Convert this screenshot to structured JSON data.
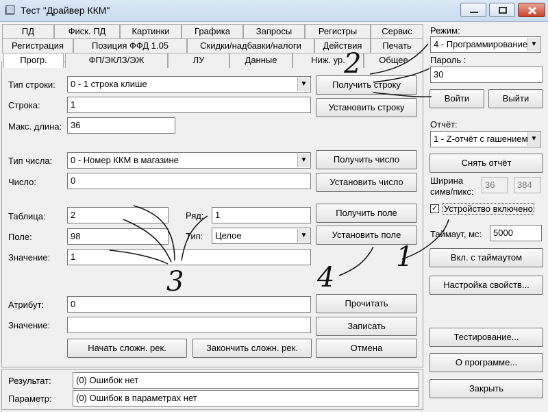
{
  "window": {
    "title": "Тест \"Драйвер ККМ\"",
    "controls": [
      "minimize",
      "maximize",
      "close"
    ]
  },
  "tabs": {
    "row1": [
      "ПД",
      "Фиск. ПД",
      "Картинки",
      "Графика",
      "Запросы",
      "Регистры",
      "Сервис"
    ],
    "row2": [
      "Регистрация",
      "Позиция ФФД 1.05",
      "Скидки/надбавки/налоги",
      "Действия",
      "Печать"
    ],
    "row3": [
      "Прогр.",
      "ФП/ЭКЛЗ/ЭЖ",
      "ЛУ",
      "Данные",
      "Ниж. ур.",
      "Общее"
    ],
    "active": "Прогр."
  },
  "form": {
    "line_type_label": "Тип строки:",
    "line_type_value": "0 - 1 строка клише",
    "get_line_btn": "Получить строку",
    "line_label": "Строка:",
    "line_value": "1",
    "set_line_btn": "Установить строку",
    "maxlen_label": "Макс. длина:",
    "maxlen_value": "36",
    "num_type_label": "Тип числа:",
    "num_type_value": "0 - Номер ККМ в магазине",
    "get_num_btn": "Получить число",
    "num_label": "Число:",
    "num_value": "0",
    "set_num_btn": "Установить число",
    "table_label": "Таблица:",
    "table_value": "2",
    "row_label": "Ряд:",
    "row_value": "1",
    "get_field_btn": "Получить поле",
    "field_label": "Поле:",
    "field_value": "98",
    "type_label": "Тип:",
    "type_value": "Целое",
    "set_field_btn": "Установить поле",
    "value_label": "Значение:",
    "value_value": "1",
    "attr_label": "Атрибут:",
    "attr_value": "0",
    "read_btn": "Прочитать",
    "value2_label": "Значение:",
    "value2_value": "",
    "write_btn": "Записать",
    "start_btn": "Начать сложн. рек.",
    "finish_btn": "Закончить сложн. рек.",
    "cancel_btn": "Отмена"
  },
  "result": {
    "result_label": "Результат:",
    "result_value": "(0) Ошибок нет",
    "param_label": "Параметр:",
    "param_value": "(0) Ошибок в параметрах нет"
  },
  "right": {
    "mode_label": "Режим:",
    "mode_value": "4 - Программирование",
    "password_label": "Пароль :",
    "password_value": "30",
    "login_btn": "Войти",
    "logout_btn": "Выйти",
    "report_label": "Отчёт:",
    "report_value": "1 - Z-отчёт с гашением",
    "take_report_btn": "Снять отчёт",
    "width_label_1": "Ширина",
    "width_label_2": "симв/пикс:",
    "width_chars": "36",
    "width_pixels": "384",
    "device_on_label": "Устройство включено",
    "device_on_checked": true,
    "timeout_label": "Таймаут, мс:",
    "timeout_value": "5000",
    "enable_timeout_btn": "Вкл. с таймаутом",
    "props_btn": "Настройка свойств...",
    "testing_btn": "Тестирование...",
    "about_btn": "О программе...",
    "close_btn": "Закрыть"
  },
  "annotations": {
    "n1": "1",
    "n2": "2",
    "n3": "3",
    "n4": "4"
  }
}
